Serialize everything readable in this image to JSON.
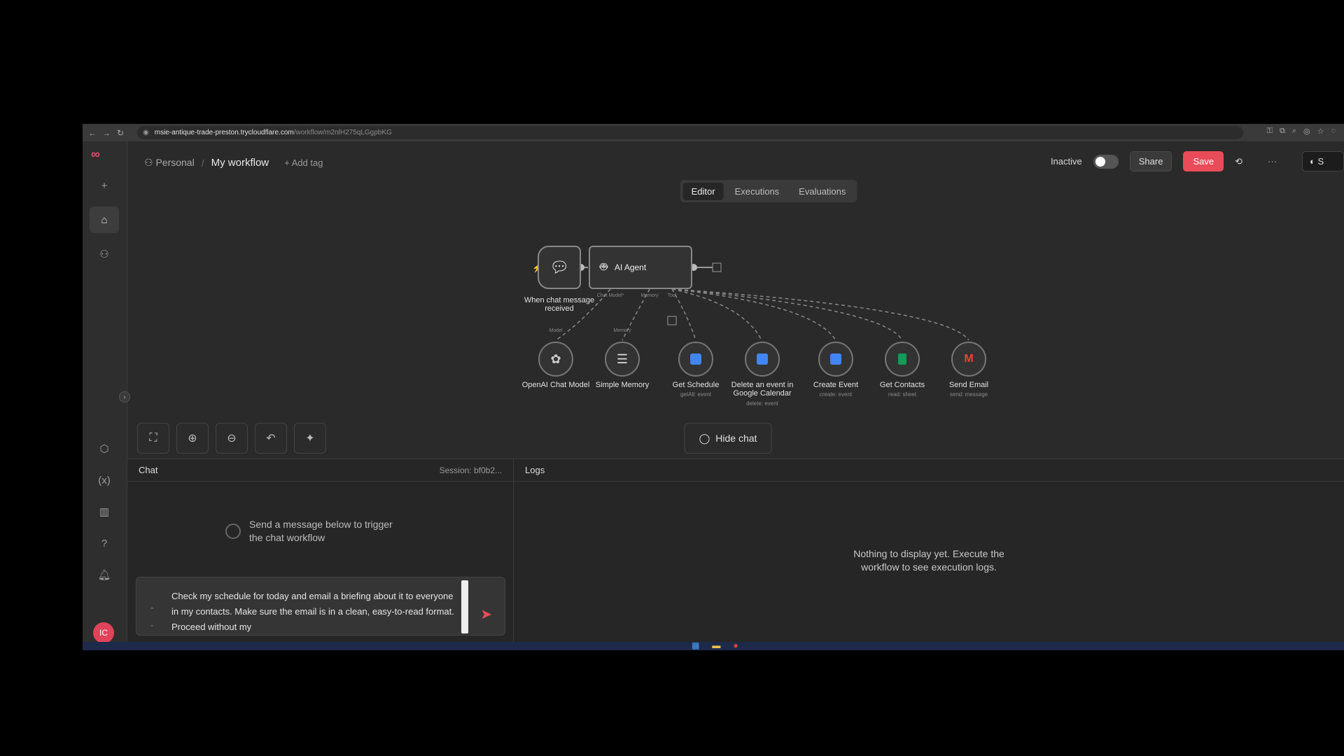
{
  "browser": {
    "url_domain": "msie-antique-trade-preston.trycloudflare.com",
    "url_path": "/workflow/m2nlH275qLGgpbKG"
  },
  "header": {
    "project": "Personal",
    "workflow_name": "My workflow",
    "add_tag": "+ Add tag",
    "status": "Inactive",
    "share": "Share",
    "save": "Save",
    "more": "···",
    "github_label": "S"
  },
  "tabs": [
    "Editor",
    "Executions",
    "Evaluations"
  ],
  "nodes": {
    "trigger": {
      "label_line1": "When chat message",
      "label_line2": "received"
    },
    "agent": {
      "label": "AI Agent"
    },
    "ports": {
      "chat_model": "Chat Model*",
      "memory": "Memory",
      "tool": "Tool"
    },
    "subnodes": [
      {
        "name": "OpenAI Chat Model",
        "sub": "",
        "port": "Model",
        "color": "#bdbdbd"
      },
      {
        "name": "Simple Memory",
        "sub": "",
        "port": "Memory",
        "color": "#bdbdbd"
      },
      {
        "name": "Get Schedule",
        "sub": "getAll: event",
        "port": "",
        "color": "#4285f4"
      },
      {
        "name": "Delete an event in",
        "name2": "Google Calendar",
        "sub": "delete: event",
        "port": "",
        "color": "#4285f4"
      },
      {
        "name": "Create Event",
        "sub": "create: event",
        "port": "",
        "color": "#4285f4"
      },
      {
        "name": "Get Contacts",
        "sub": "read: sheet",
        "port": "",
        "color": "#0f9d58"
      },
      {
        "name": "Send Email",
        "sub": "send: message",
        "port": "",
        "color": "#ea4335"
      }
    ]
  },
  "hide_chat": "Hide chat",
  "chat": {
    "title": "Chat",
    "session": "Session: bf0b2...",
    "empty_line1": "Send a message below to trigger",
    "empty_line2": "the chat workflow",
    "input_value": "Check my schedule for today and email a briefing about it to everyone in my contacts. Make sure the email is in a clean, easy-to-read format. Proceed without my"
  },
  "logs": {
    "title": "Logs",
    "empty_line1": "Nothing to display yet. Execute the",
    "empty_line2": "workflow to see execution logs."
  },
  "user": {
    "initials": "IC"
  },
  "colors": {
    "accent": "#ea4b59",
    "canvas_bg": "#2a2a2a"
  }
}
